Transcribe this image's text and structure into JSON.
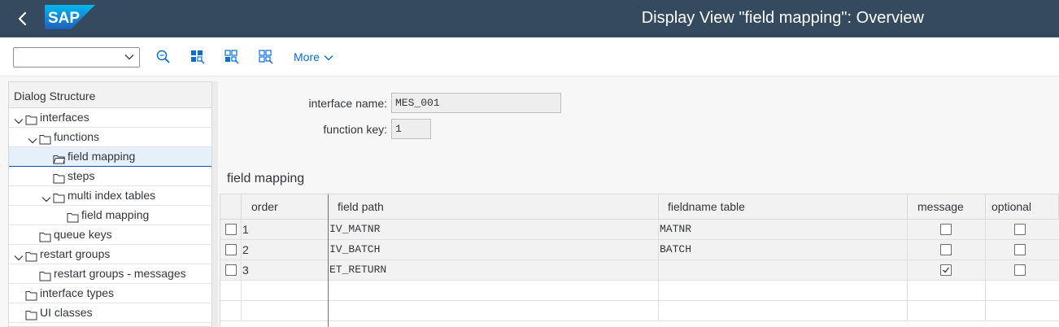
{
  "shell": {
    "title": "Display View \"field mapping\": Overview",
    "logo_text": "SAP",
    "brand_color": "#0a6ed1",
    "header_color": "#354a5f",
    "icons": {
      "back": "chevron-left-icon"
    }
  },
  "toolbar": {
    "select_value": "",
    "more_label": "More",
    "icons": [
      "find-icon",
      "select-all-icon",
      "select-block-icon",
      "deselect-all-icon"
    ]
  },
  "dialog_structure": {
    "title": "Dialog Structure",
    "items": [
      {
        "label": "interfaces",
        "level": 0,
        "expanded": true,
        "selected": false
      },
      {
        "label": "functions",
        "level": 1,
        "expanded": true,
        "selected": false
      },
      {
        "label": "field mapping",
        "level": 2,
        "expanded": false,
        "selected": true
      },
      {
        "label": "steps",
        "level": 2,
        "expanded": false,
        "selected": false
      },
      {
        "label": "multi index tables",
        "level": 2,
        "expanded": true,
        "selected": false
      },
      {
        "label": "field mapping",
        "level": 3,
        "expanded": false,
        "selected": false
      },
      {
        "label": "queue keys",
        "level": 1,
        "expanded": false,
        "selected": false
      },
      {
        "label": "restart groups",
        "level": 0,
        "expanded": true,
        "selected": false
      },
      {
        "label": "restart groups - messages",
        "level": 1,
        "expanded": false,
        "selected": false
      },
      {
        "label": "interface types",
        "level": 0,
        "expanded": false,
        "selected": false
      },
      {
        "label": "UI classes",
        "level": 0,
        "expanded": false,
        "selected": false
      }
    ]
  },
  "form": {
    "interface_name_label": "interface name:",
    "interface_name_value": "MES_001",
    "function_key_label": "function key:",
    "function_key_value": "1"
  },
  "table": {
    "title": "field mapping",
    "columns": [
      "order",
      "field path",
      "fieldname table",
      "message",
      "optional"
    ],
    "rows": [
      {
        "order": "1",
        "field_path": "IV_MATNR",
        "fieldname_table": "MATNR",
        "message": false,
        "optional": false
      },
      {
        "order": "2",
        "field_path": "IV_BATCH",
        "fieldname_table": "BATCH",
        "message": false,
        "optional": false
      },
      {
        "order": "3",
        "field_path": "ET_RETURN",
        "fieldname_table": "",
        "message": true,
        "optional": false
      }
    ]
  }
}
